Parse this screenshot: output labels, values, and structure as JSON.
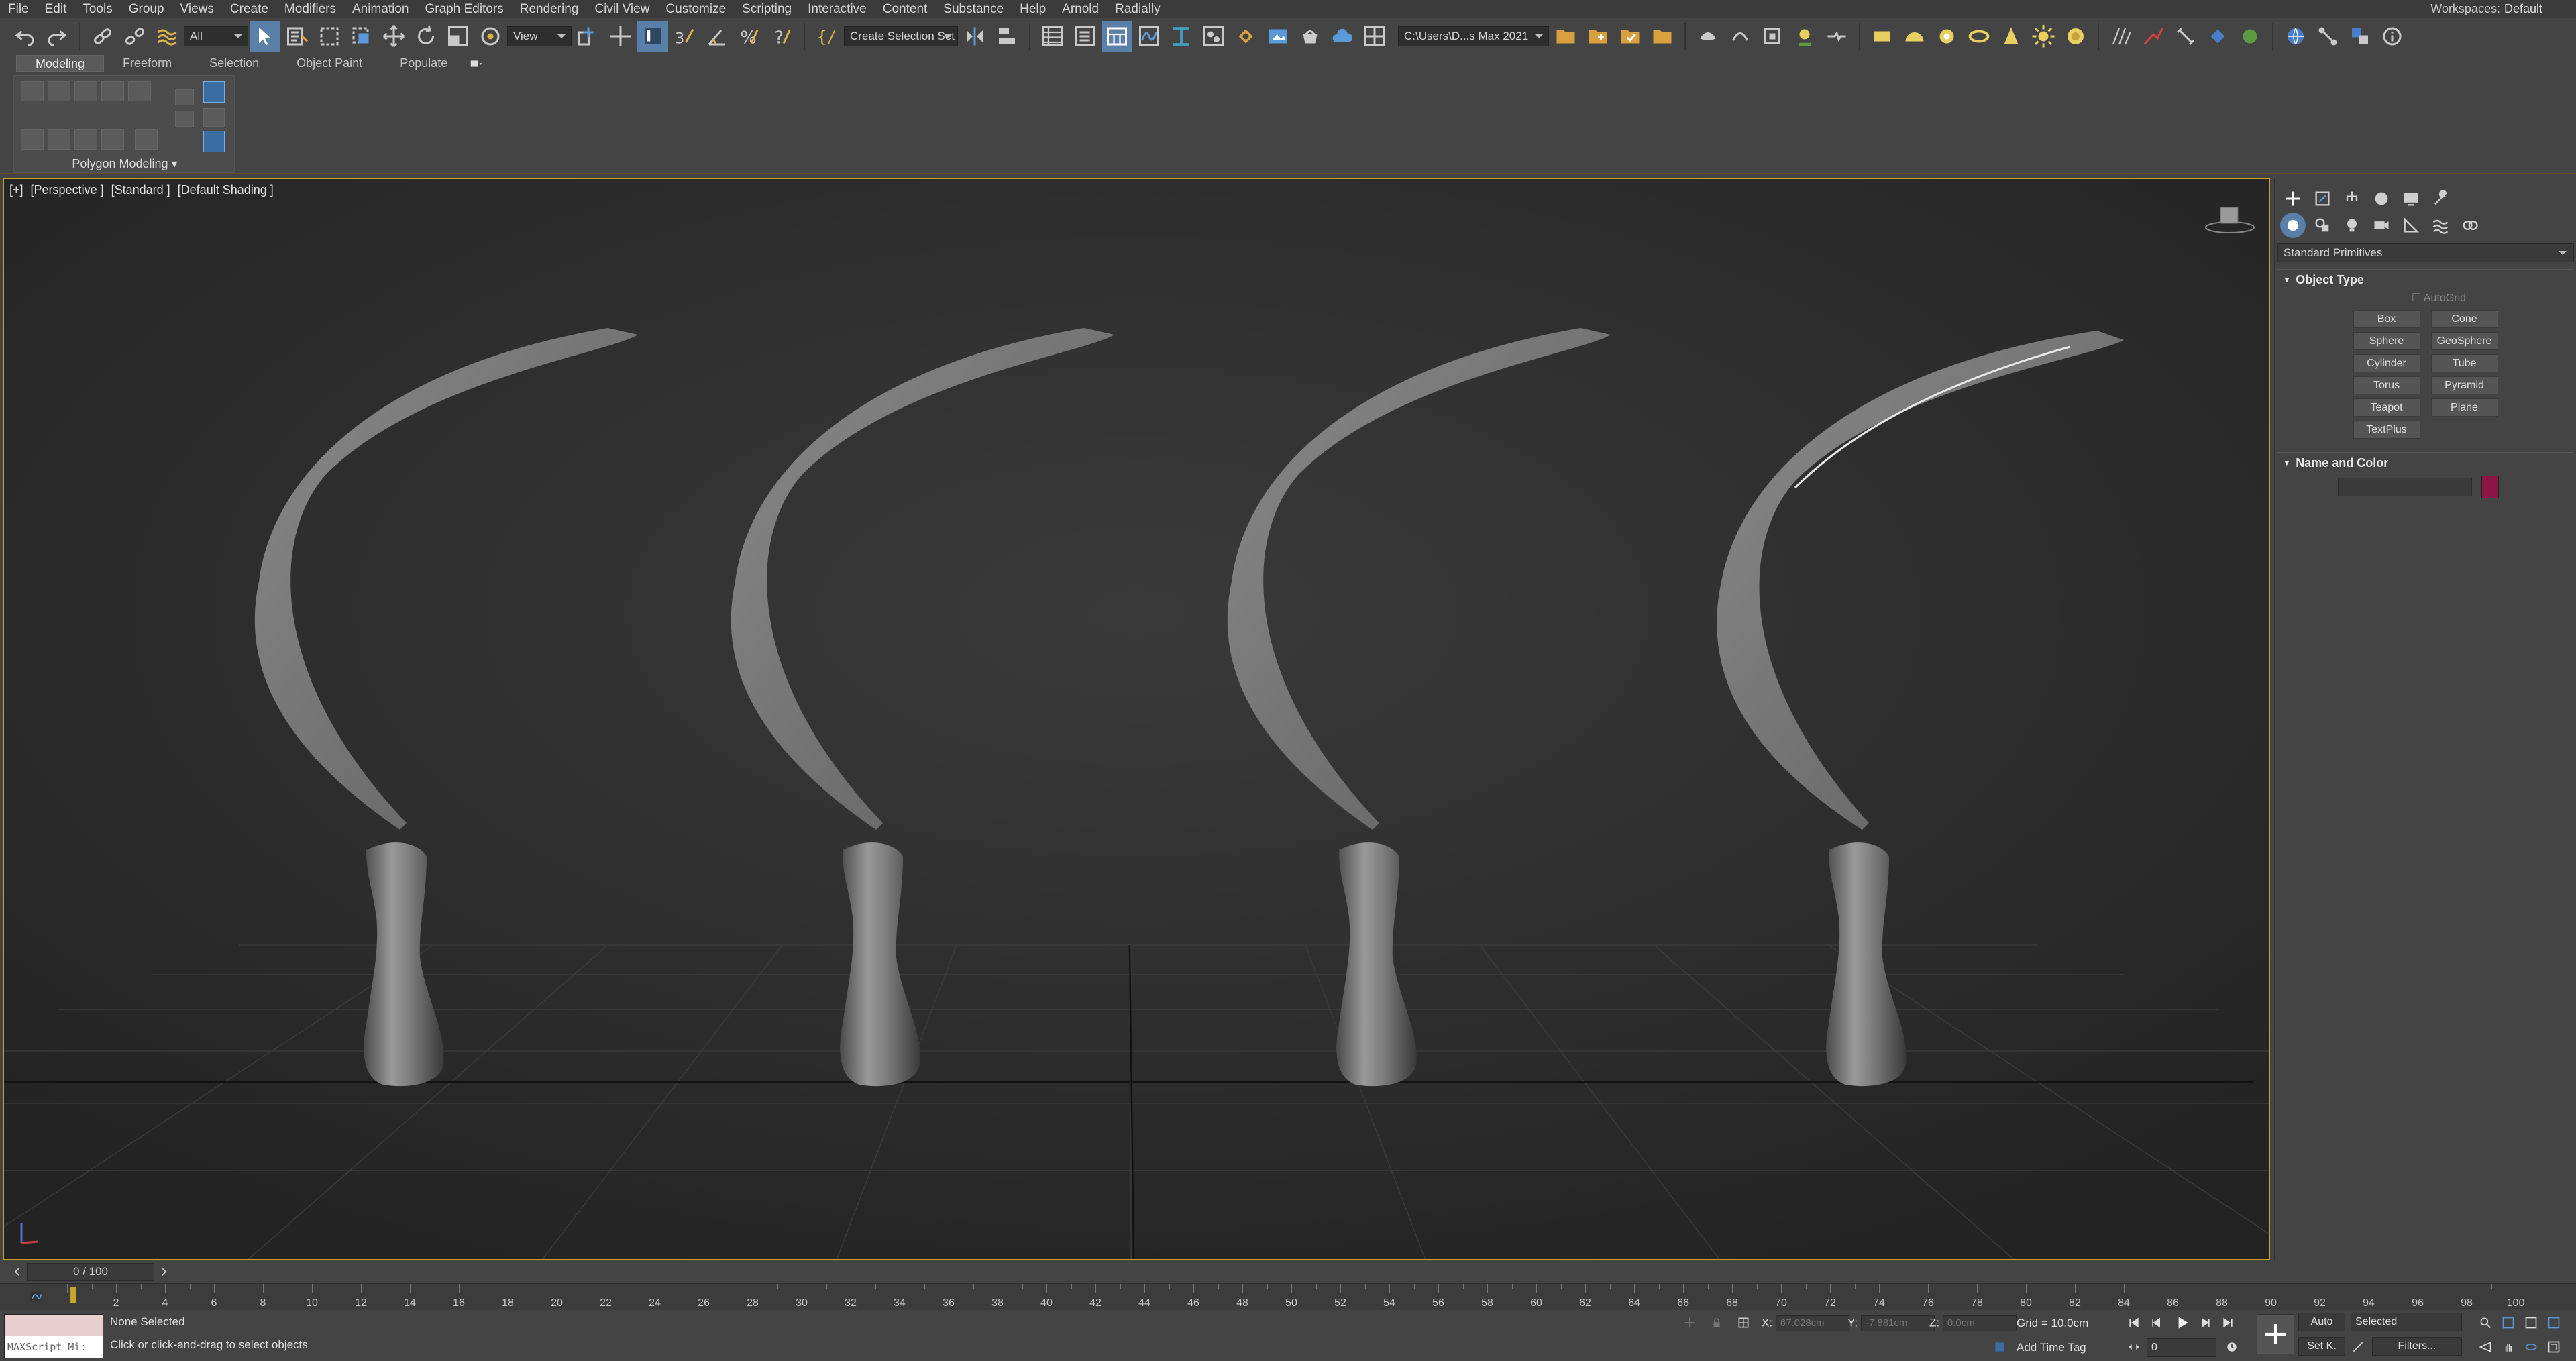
{
  "menu": [
    "File",
    "Edit",
    "Tools",
    "Group",
    "Views",
    "Create",
    "Modifiers",
    "Animation",
    "Graph Editors",
    "Rendering",
    "Civil View",
    "Customize",
    "Scripting",
    "Interactive",
    "Content",
    "Substance",
    "Help",
    "Arnold",
    "Radially"
  ],
  "workspaces": {
    "label": "Workspaces:",
    "value": "Default"
  },
  "toolbar": {
    "selection_filter": "All",
    "ref_coord": "View",
    "named_selection": "Create Selection Set",
    "project_path": "C:\\Users\\D...s Max 2021"
  },
  "ribbon": {
    "tabs": [
      "Modeling",
      "Freeform",
      "Selection",
      "Object Paint",
      "Populate"
    ],
    "active_tab": "Modeling",
    "panel_label": "Polygon Modeling"
  },
  "viewport": {
    "labels": [
      "[+]",
      "[Perspective ]",
      "[Standard ]",
      "[Default Shading ]"
    ],
    "border_color": "#c8a32a",
    "objects": [
      "sickle-1",
      "sickle-2",
      "sickle-3",
      "sickle-4"
    ]
  },
  "command_panel": {
    "category": "Standard Primitives",
    "object_type_title": "Object Type",
    "autogrid": "AutoGrid",
    "buttons": [
      "Box",
      "Cone",
      "Sphere",
      "GeoSphere",
      "Cylinder",
      "Tube",
      "Torus",
      "Pyramid",
      "Teapot",
      "Plane",
      "TextPlus"
    ],
    "name_color_title": "Name and Color",
    "object_color": "#8a1646"
  },
  "timeline": {
    "frame_display": "0 / 100",
    "ticks": [
      "2",
      "4",
      "6",
      "8",
      "10",
      "12",
      "14",
      "16",
      "18",
      "20",
      "22",
      "24",
      "26",
      "28",
      "30",
      "32",
      "34",
      "36",
      "38",
      "40",
      "42",
      "44",
      "46",
      "48",
      "50",
      "52",
      "54",
      "56",
      "58",
      "60",
      "62",
      "64",
      "66",
      "68",
      "70",
      "72",
      "74",
      "76",
      "78",
      "80",
      "82",
      "84",
      "86",
      "88",
      "90",
      "92",
      "94",
      "96",
      "98",
      "100"
    ]
  },
  "status": {
    "maxscript_label": "MAXScript Mi:",
    "selection": "None Selected",
    "prompt": "Click or click-and-drag to select objects",
    "x_label": "X:",
    "x_value": "67.028cm",
    "y_label": "Y:",
    "y_value": "-7.881cm",
    "z_label": "Z:",
    "z_value": "0.0cm",
    "grid": "Grid = 10.0cm",
    "add_time_tag": "Add Time Tag",
    "auto": "Auto",
    "setk": "Set K.",
    "key_filter": "Selected",
    "filters": "Filters...",
    "current_frame": "0"
  }
}
